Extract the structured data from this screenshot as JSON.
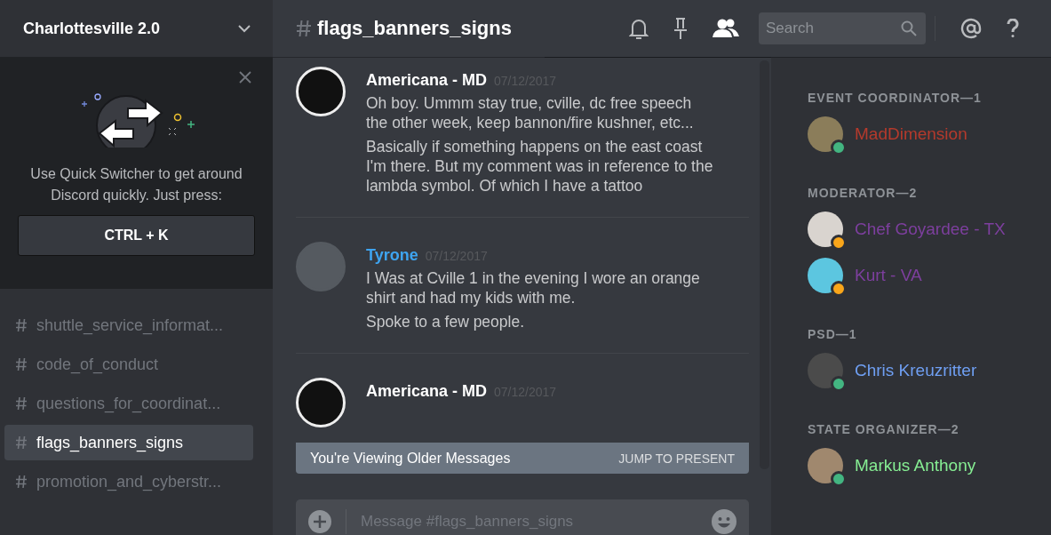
{
  "server": {
    "name": "Charlottesville 2.0"
  },
  "quick_switcher": {
    "text": "Use Quick Switcher to get around Discord quickly. Just press:",
    "shortcut": "CTRL + K"
  },
  "channels": [
    {
      "name": "shuttle_service_informat...",
      "selected": false
    },
    {
      "name": "code_of_conduct",
      "selected": false
    },
    {
      "name": "questions_for_coordinat...",
      "selected": false
    },
    {
      "name": "flags_banners_signs",
      "selected": true
    },
    {
      "name": "promotion_and_cyberstr...",
      "selected": false
    }
  ],
  "channel_header": {
    "name": "flags_banners_signs"
  },
  "search": {
    "placeholder": "Search"
  },
  "messages": [
    {
      "author": "Americana - MD",
      "color": "#ffffff",
      "timestamp": "07/12/2017",
      "paragraphs": [
        "Oh boy. Ummm stay true, cville, dc free speech the other week, keep bannon/fire kushner, etc...",
        "Basically if something happens on the east coast I'm there. But my comment was in reference to the lambda symbol. Of which I have a tattoo"
      ]
    },
    {
      "author": "Tyrone",
      "color": "#3ea4f0",
      "timestamp": "07/12/2017",
      "paragraphs": [
        "I Was at Cville 1 in the evening I wore an orange shirt and had my kids with me.",
        "Spoke to a few people."
      ]
    },
    {
      "author": "Americana - MD",
      "color": "#ffffff",
      "timestamp": "07/12/2017"
    }
  ],
  "older_messages_bar": {
    "text": "You're Viewing Older Messages",
    "action": "JUMP TO PRESENT"
  },
  "composer": {
    "placeholder": "Message #flags_banners_signs"
  },
  "member_groups": [
    {
      "title": "EVENT COORDINATOR—1",
      "members": [
        {
          "name": "MadDimension",
          "color": "#b53a2c",
          "status_dot": {
            "color": "#43b581"
          }
        }
      ]
    },
    {
      "title": "MODERATOR—2",
      "members": [
        {
          "name": "Chef Goyardee - TX",
          "color": "#7d3f9e",
          "status_dot": {
            "color": "#faa61a"
          }
        },
        {
          "name": "Kurt - VA",
          "color": "#7d3f9e",
          "status_dot": {
            "color": "#faa61a"
          }
        }
      ]
    },
    {
      "title": "PSD—1",
      "members": [
        {
          "name": "Chris Kreuzritter",
          "color": "#6f9ff3",
          "status_dot": {
            "color": "#43b581"
          }
        }
      ]
    },
    {
      "title": "STATE ORGANIZER—2",
      "members": [
        {
          "name": "Markus Anthony",
          "color": "#86ee93",
          "status_dot": {
            "color": "#43b581"
          }
        }
      ]
    }
  ]
}
